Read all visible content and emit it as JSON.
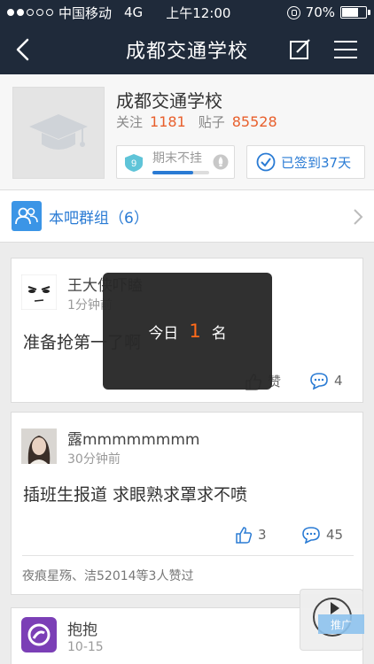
{
  "status_bar": {
    "carrier": "中国移动",
    "network": "4G",
    "time": "上午12:00",
    "battery": "70%",
    "battery_level": 0.7,
    "signal_bars": [
      true,
      true,
      false,
      false,
      false
    ]
  },
  "nav": {
    "title": "成都交通学校",
    "back_icon": "chevron-left-icon",
    "edit_icon": "edit-icon",
    "menu_icon": "menu-icon"
  },
  "forum": {
    "name": "成都交通学校",
    "follow_label": "关注",
    "follow_count": "1181",
    "posts_label": "贴子",
    "posts_count": "85528",
    "level": "9",
    "level_title": "期末不挂",
    "level_progress": 0.72,
    "signed_text": "已签到37天"
  },
  "group": {
    "label": "本吧群组（6）"
  },
  "posts": [
    {
      "user": "王大侠吓瞌",
      "time": "1分钟前",
      "content": "准备抢第一了啊",
      "likes": "赞",
      "comments": "4"
    },
    {
      "user": "露mmmmmmmm",
      "time": "30分钟前",
      "content": "插班生报道 求眼熟求罩求不喷",
      "likes": "3",
      "comments": "45",
      "liked_by": "夜痕星殇、洁52014等3人赞过"
    },
    {
      "user": "抱抱",
      "time": "10-15"
    }
  ],
  "toast": {
    "prefix": "今日",
    "rank": "1",
    "suffix": "名"
  },
  "refresh": {
    "tag": "推广"
  },
  "colors": {
    "nav_bg": "#1f2a3a",
    "accent_blue": "#2a7bd4",
    "accent_orange": "#e85f2c"
  }
}
